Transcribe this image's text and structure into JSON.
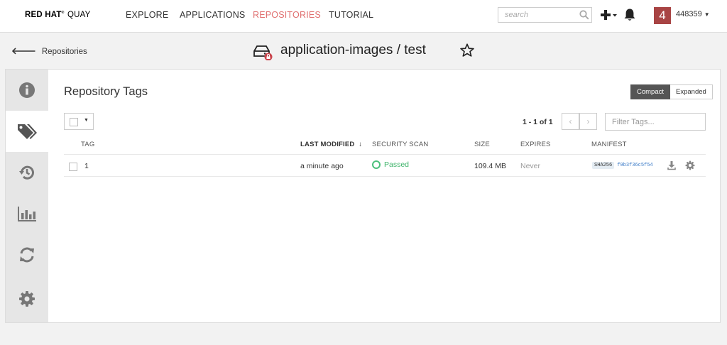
{
  "brand": {
    "red_hat": "RED HAT",
    "reg": "®",
    "product": "QUAY"
  },
  "nav": {
    "explore": "EXPLORE",
    "applications": "APPLICATIONS",
    "repositories": "REPOSITORIES",
    "tutorial": "TUTORIAL"
  },
  "search": {
    "placeholder": "search"
  },
  "user": {
    "notifications_count": "4",
    "name": "448359"
  },
  "header": {
    "back_label": "Repositories",
    "repo_title": "application-images / test"
  },
  "sidebar": {
    "tabs": [
      {
        "icon": "info-icon"
      },
      {
        "icon": "tags-icon"
      },
      {
        "icon": "history-icon"
      },
      {
        "icon": "usage-logs-icon"
      },
      {
        "icon": "builds-icon"
      },
      {
        "icon": "settings-icon"
      }
    ],
    "active_index": 1
  },
  "tags": {
    "title": "Repository Tags",
    "view_compact": "Compact",
    "view_expanded": "Expanded",
    "paging": "1 - 1 of 1",
    "filter_placeholder": "Filter Tags...",
    "columns": {
      "tag": "TAG",
      "last_modified": "LAST MODIFIED",
      "sort_arrow": "↓",
      "security_scan": "SECURITY SCAN",
      "size": "SIZE",
      "expires": "EXPIRES",
      "manifest": "MANIFEST"
    },
    "rows": [
      {
        "tag": "1",
        "last_modified": "a minute ago",
        "security_scan": "Passed",
        "size": "109.4 MB",
        "expires": "Never",
        "manifest_algo": "SHA256",
        "manifest_digest": "f9b3f36c5f54"
      }
    ]
  },
  "colors": {
    "active_nav": "#e06f6f",
    "passed": "#3fb46b",
    "avatar": "#a84444"
  }
}
